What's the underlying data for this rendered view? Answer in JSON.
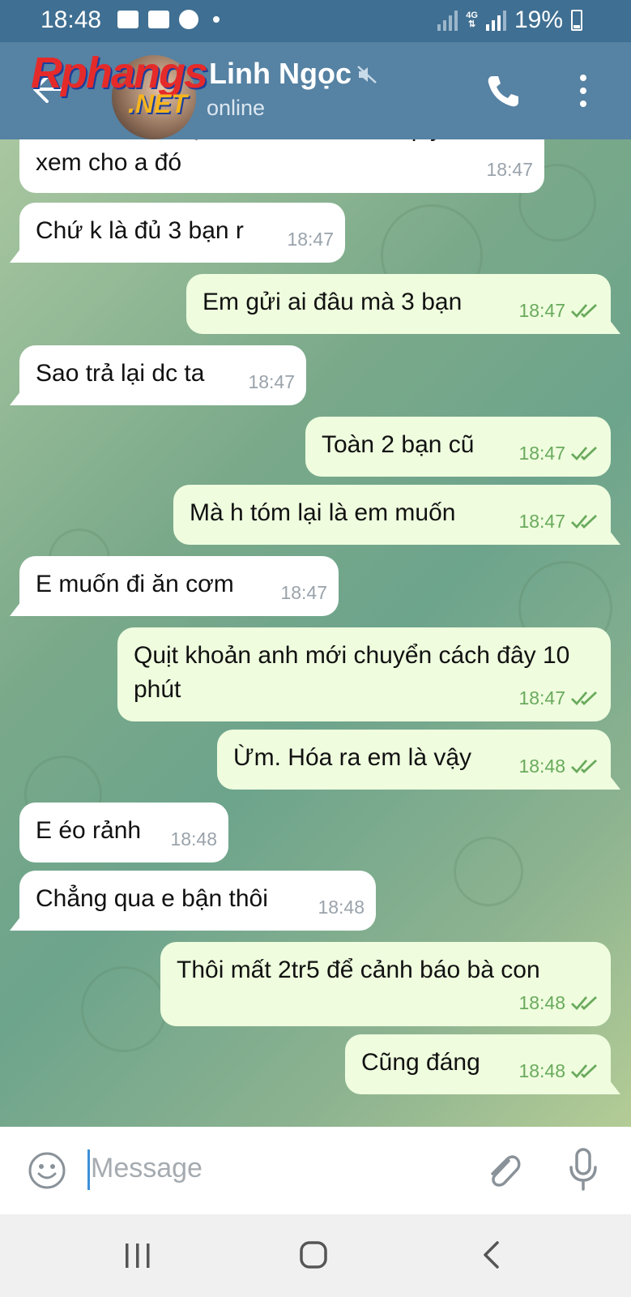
{
  "status_bar": {
    "time": "18:48",
    "network": "4G",
    "battery": "19%"
  },
  "header": {
    "contact_name": "Linh Ngọc",
    "status": "online",
    "watermark": "Rphangs",
    "watermark_suffix": ".NET",
    "icons": [
      "back-arrow-icon",
      "mute-icon",
      "phone-icon",
      "more-vertical-icon"
    ]
  },
  "messages": [
    {
      "dir": "in",
      "text": "xem cho a đó",
      "time": "18:47"
    },
    {
      "dir": "in",
      "text": "Chứ k là đủ 3 bạn r",
      "time": "18:47"
    },
    {
      "dir": "out",
      "text": "Em gửi ai đâu mà 3 bạn",
      "time": "18:47",
      "read": true
    },
    {
      "dir": "in",
      "text": "Sao trả lại dc ta",
      "time": "18:47"
    },
    {
      "dir": "out",
      "text": "Toàn 2 bạn cũ",
      "time": "18:47",
      "read": true
    },
    {
      "dir": "out",
      "text": "Mà h tóm lại là em muốn",
      "time": "18:47",
      "read": true
    },
    {
      "dir": "in",
      "text": "E muốn đi ăn cơm",
      "time": "18:47"
    },
    {
      "dir": "out",
      "text": "Quịt khoản anh mới chuyển cách đây 10 phút",
      "time": "18:47",
      "read": true
    },
    {
      "dir": "out",
      "text": "Ừm. Hóa ra em là vậy",
      "time": "18:48",
      "read": true
    },
    {
      "dir": "in",
      "text": "E éo rảnh",
      "time": "18:48"
    },
    {
      "dir": "in",
      "text": "Chẳng qua e bận thôi",
      "time": "18:48"
    },
    {
      "dir": "out",
      "text": "Thôi mất 2tr5 để cảnh báo bà con",
      "time": "18:48",
      "read": true
    },
    {
      "dir": "out",
      "text": "Cũng đáng",
      "time": "18:48",
      "read": true
    }
  ],
  "composer": {
    "placeholder": "Message",
    "icons": [
      "emoji-icon",
      "attach-icon",
      "microphone-icon"
    ]
  },
  "colors": {
    "header": "#5682a3",
    "status_bar": "#3f6f92",
    "incoming_bubble": "#ffffff",
    "outgoing_bubble": "#effdde",
    "outgoing_meta": "#6aaa5d"
  }
}
